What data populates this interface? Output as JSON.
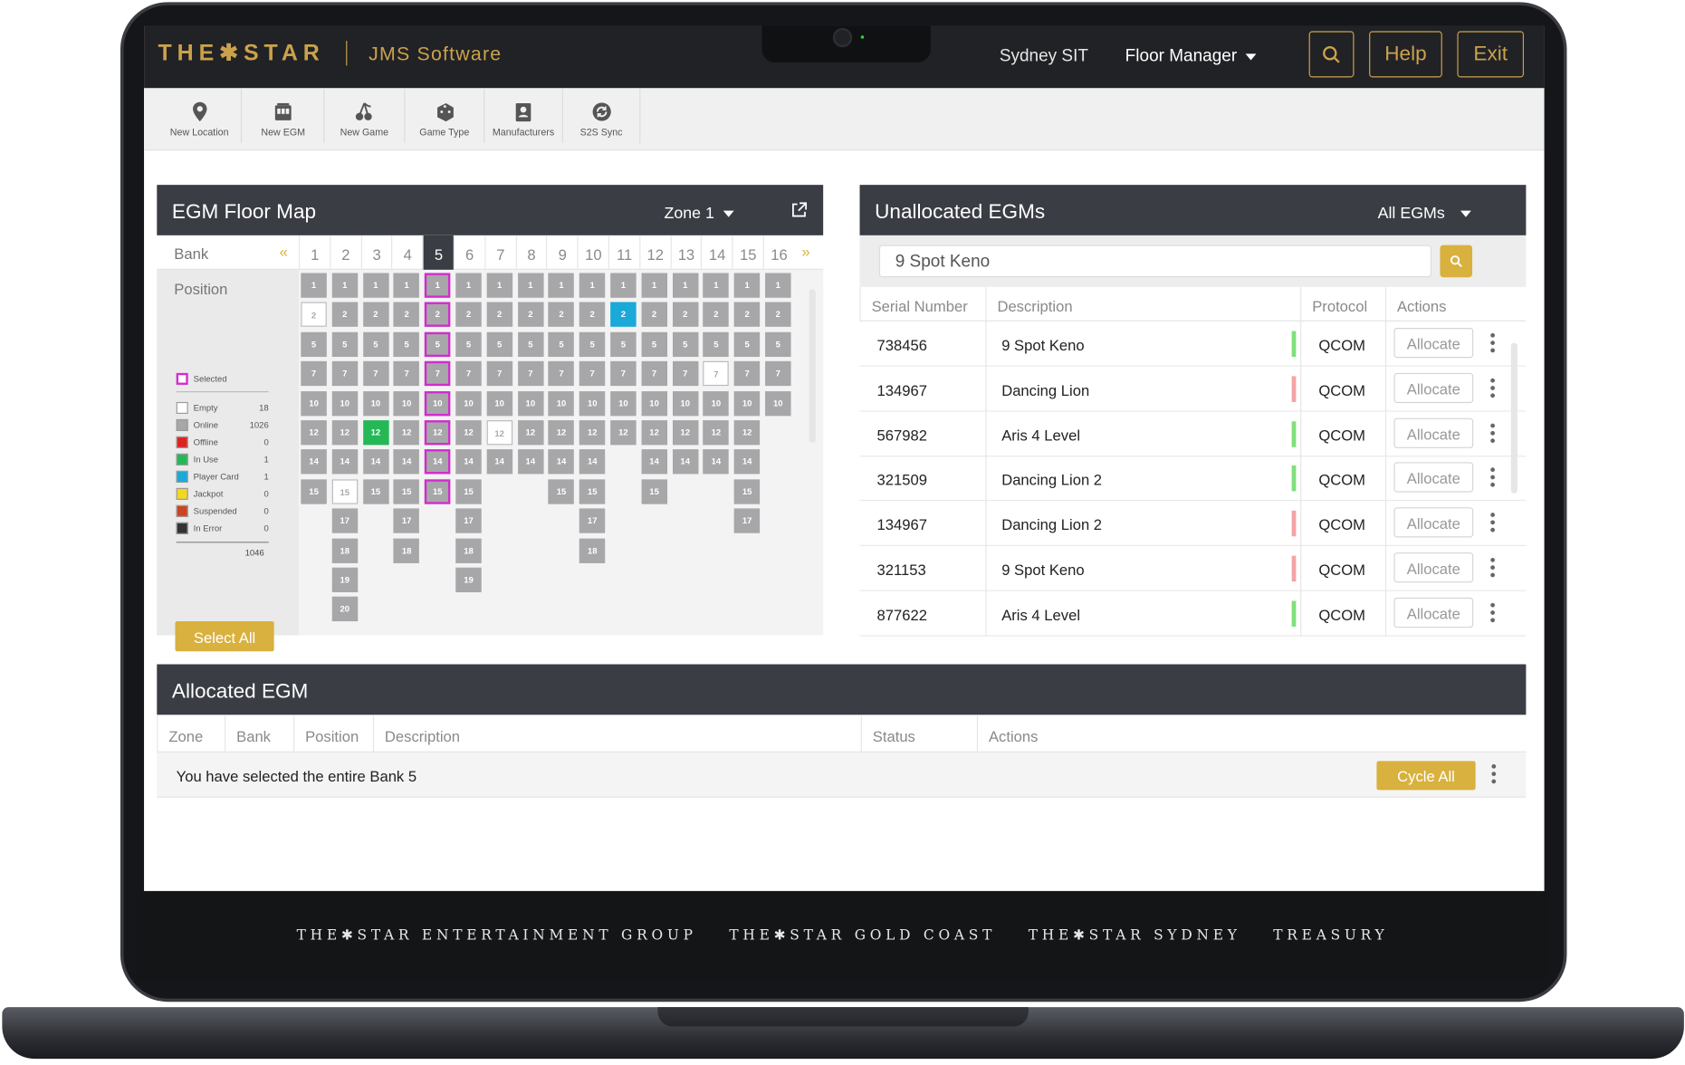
{
  "header": {
    "brand": "THE✱STAR",
    "app_name": "JMS Software",
    "site": "Sydney SIT",
    "role": "Floor Manager",
    "help_label": "Help",
    "exit_label": "Exit",
    "search_icon": "search-icon"
  },
  "toolbar": [
    {
      "label": "New Location",
      "icon": "location-pin-icon"
    },
    {
      "label": "New EGM",
      "icon": "slot-machine-icon"
    },
    {
      "label": "New Game",
      "icon": "cherries-icon"
    },
    {
      "label": "Game Type",
      "icon": "dice-icon"
    },
    {
      "label": "Manufacturers",
      "icon": "contact-book-icon"
    },
    {
      "label": "S2S Sync",
      "icon": "sync-icon"
    }
  ],
  "floor_map": {
    "title": "EGM Floor Map",
    "zone": "Zone 1",
    "bank_label": "Bank",
    "position_label": "Position",
    "prev": "«",
    "next": "»",
    "banks": [
      "1",
      "2",
      "3",
      "4",
      "5",
      "6",
      "7",
      "8",
      "9",
      "10",
      "11",
      "12",
      "13",
      "14",
      "15",
      "16"
    ],
    "active_bank": "5",
    "selected_label": "Selected",
    "legend": [
      {
        "label": "Empty",
        "value": "18",
        "color": "#ffffff"
      },
      {
        "label": "Online",
        "value": "1026",
        "color": "#a7a7a9"
      },
      {
        "label": "Offline",
        "value": "0",
        "color": "#e0221f"
      },
      {
        "label": "In Use",
        "value": "1",
        "color": "#26b856"
      },
      {
        "label": "Player Card",
        "value": "1",
        "color": "#1aa9d8"
      },
      {
        "label": "Jackpot",
        "value": "0",
        "color": "#f4d71f"
      },
      {
        "label": "Suspended",
        "value": "0",
        "color": "#c9461e"
      },
      {
        "label": "In Error",
        "value": "0",
        "color": "#333333"
      }
    ],
    "total": "1046",
    "select_all_label": "Select All",
    "columns": [
      [
        {
          "n": "1"
        },
        {
          "n": "2",
          "s": "empty"
        },
        {
          "n": "5"
        },
        {
          "n": "7"
        },
        {
          "n": "10"
        },
        {
          "n": "12"
        },
        {
          "n": "14"
        },
        {
          "n": "15"
        }
      ],
      [
        {
          "n": "1"
        },
        {
          "n": "2"
        },
        {
          "n": "5"
        },
        {
          "n": "7"
        },
        {
          "n": "10"
        },
        {
          "n": "12"
        },
        {
          "n": "14"
        },
        {
          "n": "15",
          "s": "empty"
        },
        {
          "n": "17"
        },
        {
          "n": "18"
        },
        {
          "n": "19"
        },
        {
          "n": "20"
        }
      ],
      [
        {
          "n": "1"
        },
        {
          "n": "2"
        },
        {
          "n": "5"
        },
        {
          "n": "7"
        },
        {
          "n": "10"
        },
        {
          "n": "12",
          "s": "inuse"
        },
        {
          "n": "14"
        },
        {
          "n": "15"
        }
      ],
      [
        {
          "n": "1"
        },
        {
          "n": "2"
        },
        {
          "n": "5"
        },
        {
          "n": "7"
        },
        {
          "n": "10"
        },
        {
          "n": "12"
        },
        {
          "n": "14"
        },
        {
          "n": "15"
        },
        {
          "n": "17"
        },
        {
          "n": "18"
        }
      ],
      [
        {
          "n": "1",
          "s": "sel"
        },
        {
          "n": "2",
          "s": "sel"
        },
        {
          "n": "5",
          "s": "sel"
        },
        {
          "n": "7",
          "s": "sel"
        },
        {
          "n": "10",
          "s": "sel"
        },
        {
          "n": "12",
          "s": "sel"
        },
        {
          "n": "14",
          "s": "sel"
        },
        {
          "n": "15",
          "s": "sel"
        }
      ],
      [
        {
          "n": "1"
        },
        {
          "n": "2"
        },
        {
          "n": "5"
        },
        {
          "n": "7"
        },
        {
          "n": "10"
        },
        {
          "n": "12"
        },
        {
          "n": "14"
        },
        {
          "n": "15"
        },
        {
          "n": "17"
        },
        {
          "n": "18"
        },
        {
          "n": "19"
        }
      ],
      [
        {
          "n": "1"
        },
        {
          "n": "2"
        },
        {
          "n": "5"
        },
        {
          "n": "7"
        },
        {
          "n": "10"
        },
        {
          "n": "12",
          "s": "empty"
        },
        {
          "n": "14"
        }
      ],
      [
        {
          "n": "1"
        },
        {
          "n": "2"
        },
        {
          "n": "5"
        },
        {
          "n": "7"
        },
        {
          "n": "10"
        },
        {
          "n": "12"
        },
        {
          "n": "14"
        }
      ],
      [
        {
          "n": "1"
        },
        {
          "n": "2"
        },
        {
          "n": "5"
        },
        {
          "n": "7"
        },
        {
          "n": "10"
        },
        {
          "n": "12"
        },
        {
          "n": "14"
        },
        {
          "n": "15"
        }
      ],
      [
        {
          "n": "1"
        },
        {
          "n": "2"
        },
        {
          "n": "5"
        },
        {
          "n": "7"
        },
        {
          "n": "10"
        },
        {
          "n": "12"
        },
        {
          "n": "14"
        },
        {
          "n": "15"
        },
        {
          "n": "17"
        },
        {
          "n": "18"
        }
      ],
      [
        {
          "n": "1"
        },
        {
          "n": "2",
          "s": "pcard"
        },
        {
          "n": "5"
        },
        {
          "n": "7"
        },
        {
          "n": "10"
        },
        {
          "n": "12"
        }
      ],
      [
        {
          "n": "1"
        },
        {
          "n": "2"
        },
        {
          "n": "5"
        },
        {
          "n": "7"
        },
        {
          "n": "10"
        },
        {
          "n": "12"
        },
        {
          "n": "14"
        },
        {
          "n": "15"
        }
      ],
      [
        {
          "n": "1"
        },
        {
          "n": "2"
        },
        {
          "n": "5"
        },
        {
          "n": "7"
        },
        {
          "n": "10"
        },
        {
          "n": "12"
        },
        {
          "n": "14"
        }
      ],
      [
        {
          "n": "1"
        },
        {
          "n": "2"
        },
        {
          "n": "5"
        },
        {
          "n": "7",
          "s": "empty"
        },
        {
          "n": "10"
        },
        {
          "n": "12"
        },
        {
          "n": "14"
        }
      ],
      [
        {
          "n": "1"
        },
        {
          "n": "2"
        },
        {
          "n": "5"
        },
        {
          "n": "7"
        },
        {
          "n": "10"
        },
        {
          "n": "12"
        },
        {
          "n": "14"
        },
        {
          "n": "15"
        },
        {
          "n": "17"
        }
      ],
      [
        {
          "n": "1"
        },
        {
          "n": "2"
        },
        {
          "n": "5"
        },
        {
          "n": "7"
        },
        {
          "n": "10"
        }
      ]
    ]
  },
  "unallocated": {
    "title": "Unallocated EGMs",
    "filter": "All EGMs",
    "search_value": "9 Spot Keno",
    "columns": [
      "Serial Number",
      "Description",
      "Protocol",
      "Actions"
    ],
    "allocate_label": "Allocate",
    "rows": [
      {
        "serial": "738456",
        "description": "9 Spot Keno",
        "protocol": "QCOM",
        "status_color": "#7fe07a"
      },
      {
        "serial": "134967",
        "description": "Dancing Lion",
        "protocol": "QCOM",
        "status_color": "#f5a3a3"
      },
      {
        "serial": "567982",
        "description": "Aris 4 Level",
        "protocol": "QCOM",
        "status_color": "#7fe07a"
      },
      {
        "serial": "321509",
        "description": "Dancing Lion 2",
        "protocol": "QCOM",
        "status_color": "#7fe07a"
      },
      {
        "serial": "134967",
        "description": "Dancing Lion 2",
        "protocol": "QCOM",
        "status_color": "#f5a3a3"
      },
      {
        "serial": "321153",
        "description": "9 Spot Keno",
        "protocol": "QCOM",
        "status_color": "#f5a3a3"
      },
      {
        "serial": "877622",
        "description": "Aris 4 Level",
        "protocol": "QCOM",
        "status_color": "#7fe07a"
      }
    ]
  },
  "allocated": {
    "title": "Allocated EGM",
    "columns": [
      "Zone",
      "Bank",
      "Position",
      "Description",
      "Status",
      "Actions"
    ],
    "message": "You have selected the entire Bank 5",
    "cycle_all_label": "Cycle All"
  },
  "footer_brands": [
    "THE✱STAR ENTERTAINMENT GROUP",
    "THE✱STAR GOLD COAST",
    "THE✱STAR SYDNEY",
    "TREASURY"
  ],
  "colors": {
    "accent": "#cba24b",
    "gold_button": "#d8b13e",
    "header_bg": "#212226",
    "panel_header": "#3a3d43",
    "selected_outline": "#d32bcf"
  }
}
